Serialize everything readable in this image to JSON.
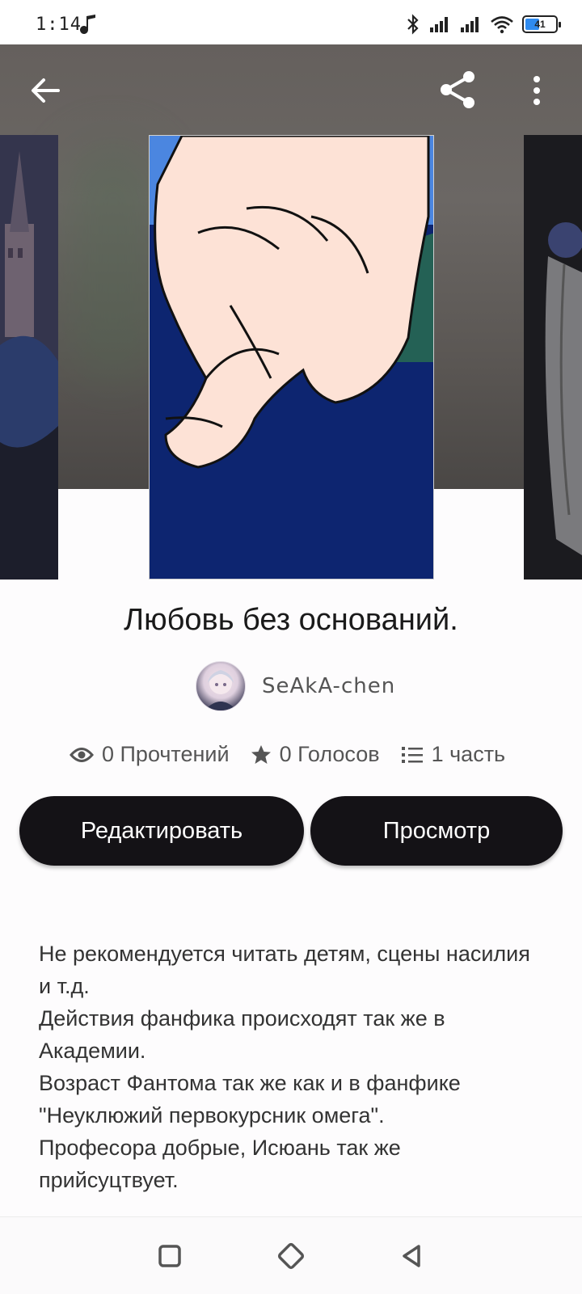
{
  "status_bar": {
    "time": "1:14",
    "battery_level": "41",
    "icons": [
      "music-note-icon",
      "bluetooth-icon",
      "signal-icon",
      "signal-icon",
      "wifi-icon",
      "battery-icon"
    ]
  },
  "toolbar": {
    "back_icon": "arrow-left-icon",
    "share_icon": "share-icon",
    "more_icon": "more-vertical-icon"
  },
  "story": {
    "title": "Любовь без оснований.",
    "author": "SeAkA-chen",
    "reads": "0 Прочтений",
    "votes": "0 Голосов",
    "parts": "1 часть"
  },
  "actions": {
    "edit_label": "Редактировать",
    "view_label": "Просмотр"
  },
  "description": [
    "Не рекомендуется читать детям, сцены насилия и т.д.",
    "Действия фанфика происходят так же в Академии.",
    "Возраст Фантома так же как и в фанфике \"Неуклюжий первокурсник омега\".",
    "Професора добрые, Исюань так же прийсуцтвует."
  ],
  "nav": {
    "icons": [
      "square-icon",
      "diamond-home-icon",
      "triangle-back-icon"
    ]
  },
  "colors": {
    "button_bg": "#141216",
    "button_text": "#ffffff",
    "header_bg": "#65605d",
    "cover_blue": "#0f2a7a"
  }
}
